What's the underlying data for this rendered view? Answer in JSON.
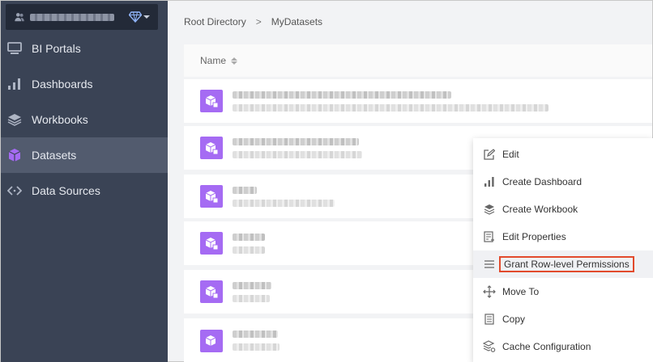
{
  "workspace": {
    "name": "Workspace"
  },
  "sidebar": {
    "items": [
      {
        "label": "BI Portals",
        "icon": "monitor-icon",
        "active": false
      },
      {
        "label": "Dashboards",
        "icon": "bar-chart-icon",
        "active": false
      },
      {
        "label": "Workbooks",
        "icon": "layers-icon",
        "active": false
      },
      {
        "label": "Datasets",
        "icon": "cube-icon",
        "active": true
      },
      {
        "label": "Data Sources",
        "icon": "code-arrows-icon",
        "active": false
      }
    ]
  },
  "breadcrumb": {
    "root": "Root Directory",
    "separator": ">",
    "current": "MyDatasets"
  },
  "table": {
    "header": "Name",
    "rows": [
      {
        "title": "",
        "subtitle": ""
      },
      {
        "title": "",
        "subtitle": ""
      },
      {
        "title": "",
        "subtitle": ""
      },
      {
        "title": "",
        "subtitle": ""
      },
      {
        "title": "",
        "subtitle": ""
      },
      {
        "title": "",
        "subtitle": ""
      }
    ]
  },
  "menu": {
    "items": [
      {
        "label": "Edit",
        "icon": "edit-icon"
      },
      {
        "label": "Create Dashboard",
        "icon": "bar-chart-icon"
      },
      {
        "label": "Create Workbook",
        "icon": "layers-icon"
      },
      {
        "label": "Edit Properties",
        "icon": "properties-icon"
      },
      {
        "label": "Grant Row-level Permissions",
        "icon": "list-icon",
        "highlighted": true
      },
      {
        "label": "Move To",
        "icon": "move-icon"
      },
      {
        "label": "Copy",
        "icon": "copy-icon"
      },
      {
        "label": "Cache Configuration",
        "icon": "cache-icon"
      }
    ]
  },
  "colors": {
    "sidebar": "#3a4355",
    "accent": "#a56bf3",
    "highlight_border": "#e24a2c"
  }
}
